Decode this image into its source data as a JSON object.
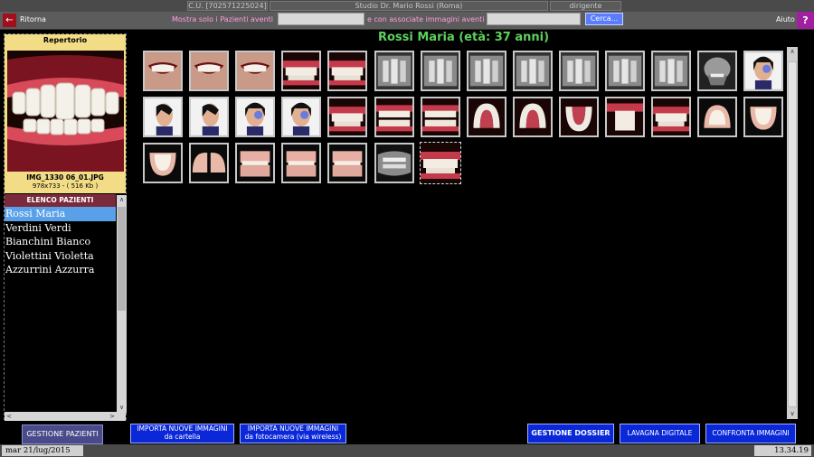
{
  "topbar": {
    "code": "C.U. [702571225024]",
    "studio": "Studio Dr. Mario Rossi (Roma)",
    "role": "dirigente"
  },
  "nav": {
    "back_label": "Ritorna",
    "filter_label": "Mostra solo i Pazienti aventi",
    "filter_value": "",
    "images_label": "e con associate immagini aventi",
    "images_value": "",
    "search_label": "Cerca...",
    "help_label": "Aiuto",
    "help_icon": "?"
  },
  "repertorio": {
    "title": "Repertorio",
    "image_name": "IMG_1330 06_01.JPG",
    "image_info": "978x733 - ( 516 Kb )"
  },
  "patients": {
    "header": "ELENCO PAZIENTI",
    "items": [
      "Rossi Maria",
      "Verdini Verdi",
      "Bianchini Bianco",
      "Violettini Violetta",
      "Azzurrini Azzurra"
    ],
    "selected_index": 0
  },
  "main": {
    "title": "Rossi Maria (età: 37 anni)",
    "thumbnail_kinds": [
      "smile",
      "smile",
      "smile",
      "teeth-close",
      "teeth-close",
      "xray",
      "xray",
      "xray",
      "xray",
      "xray",
      "xray",
      "xray",
      "xray-lateral",
      "face-front",
      "face-side",
      "face-side",
      "face-front",
      "face-front",
      "teeth-close",
      "teeth-open",
      "teeth-open",
      "arch-upper",
      "arch-upper",
      "arch-lower",
      "teeth-side",
      "teeth-close",
      "cast-upper",
      "cast-lower",
      "cast-lower",
      "cast-pair",
      "cast",
      "cast",
      "cast",
      "xray-pano",
      "teeth-close"
    ],
    "selected_thumbnail": 34
  },
  "buttons": {
    "gestione_pazienti": "GESTIONE PAZIENTI",
    "importa_cartella_1": "IMPORTA NUOVE IMMAGINI",
    "importa_cartella_2": "da cartella",
    "importa_camera_1": "IMPORTA NUOVE IMMAGINI",
    "importa_camera_2": "da fotocamera (via wireless)",
    "gestione_dossier": "GESTIONE DOSSIER",
    "lavagna": "LAVAGNA DIGITALE",
    "confronta": "CONFRONTA IMMAGINI"
  },
  "status": {
    "date": "mar 21/lug/2015",
    "time": "13.34.19"
  }
}
